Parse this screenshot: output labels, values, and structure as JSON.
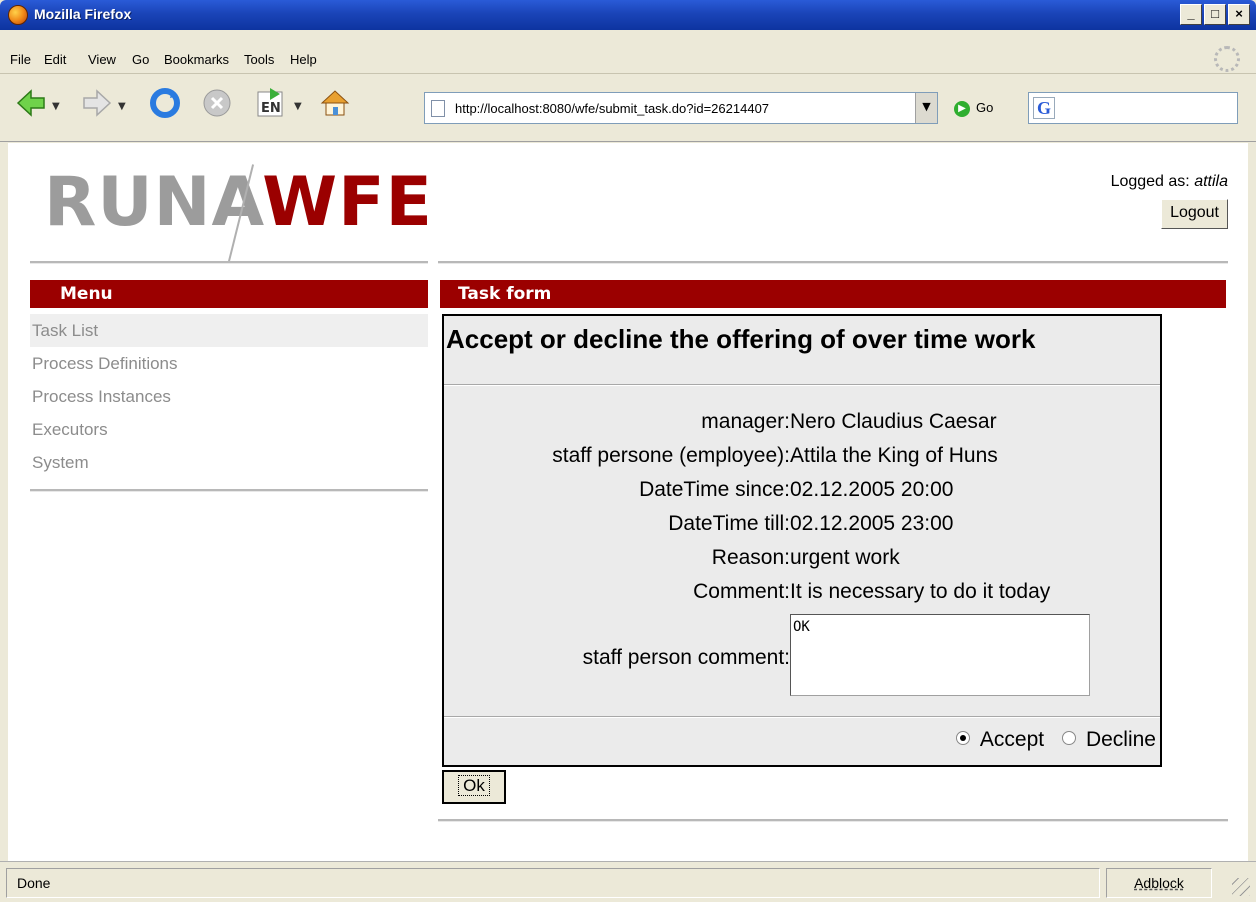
{
  "window": {
    "title": "Mozilla Firefox",
    "controls": [
      "_",
      "□",
      "×"
    ]
  },
  "menubar": {
    "items": [
      "File",
      "Edit",
      "View",
      "Go",
      "Bookmarks",
      "Tools",
      "Help"
    ]
  },
  "navbar": {
    "url": "http://localhost:8080/wfe/submit_task.do?id=26214407",
    "go_label": "Go",
    "icons": [
      "back-icon",
      "forward-icon",
      "reload-icon",
      "stop-icon",
      "language-en-icon",
      "home-icon"
    ]
  },
  "header": {
    "logo_part1": "RUNA",
    "logo_part2": "WFE",
    "logged_prefix": "Logged as:",
    "user": "attila",
    "logout_label": "Logout"
  },
  "sidebar": {
    "title": "Menu",
    "items": [
      {
        "label": "Task List"
      },
      {
        "label": "Process Definitions"
      },
      {
        "label": "Process Instances"
      },
      {
        "label": "Executors"
      },
      {
        "label": "System"
      }
    ]
  },
  "main": {
    "section_title": "Task form",
    "form_title": "Accept or decline the offering of over time work",
    "fields": [
      {
        "label": "manager:",
        "value": "Nero Claudius Caesar"
      },
      {
        "label": "staff persone (employee):",
        "value": "Attila the King of Huns"
      },
      {
        "label": "DateTime since:",
        "value": "02.12.2005 20:00"
      },
      {
        "label": "DateTime till:",
        "value": "02.12.2005 23:00"
      },
      {
        "label": "Reason:",
        "value": "urgent work"
      },
      {
        "label": "Comment:",
        "value": "It is necessary to do it today"
      }
    ],
    "comment_label": "staff person comment:",
    "comment_value": "OK",
    "radio_accept": "Accept",
    "radio_decline": "Decline",
    "ok_label": "Ok"
  },
  "statusbar": {
    "status": "Done",
    "adblock": "Adblock"
  },
  "colors": {
    "brand_red": "#9b0000",
    "logo_gray": "#9c9c9c",
    "titlebar_blue": "#1a44b8"
  }
}
